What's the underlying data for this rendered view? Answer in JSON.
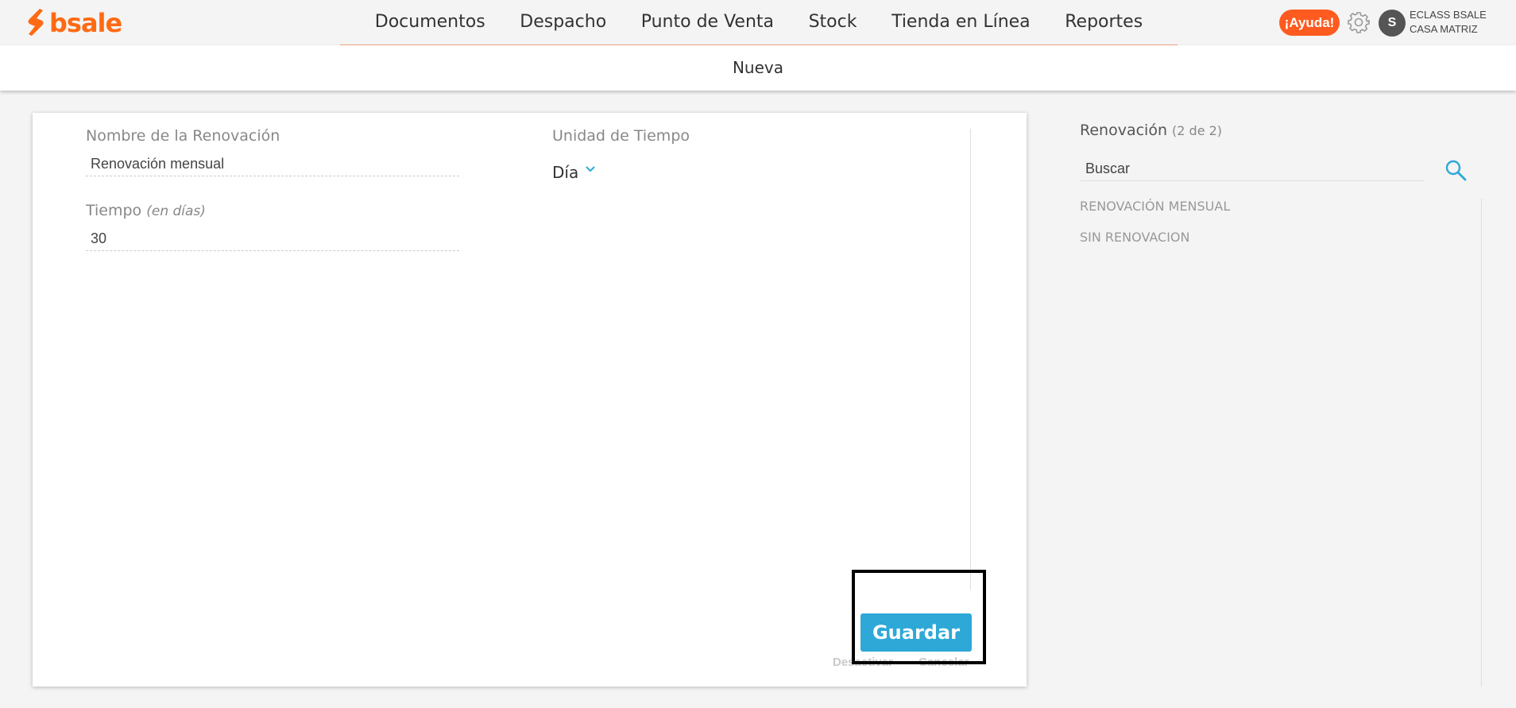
{
  "app": {
    "logo_text": "bsale",
    "brand_color": "#ff6a13"
  },
  "nav": {
    "items": [
      {
        "label": "Documentos"
      },
      {
        "label": "Despacho"
      },
      {
        "label": "Punto de Venta"
      },
      {
        "label": "Stock"
      },
      {
        "label": "Tienda en Línea"
      },
      {
        "label": "Reportes"
      }
    ]
  },
  "header": {
    "help_label": "¡Ayuda!",
    "settings_icon": "gear-icon",
    "avatar_initial": "S",
    "company_line1": "ECLASS BSALE",
    "company_line2": "CASA MATRIZ"
  },
  "subheader": {
    "title": "Nueva"
  },
  "form": {
    "name_label": "Nombre de la Renovación",
    "name_value": "Renovación mensual",
    "time_label": "Tiempo",
    "time_hint": "(en días)",
    "time_value": "30",
    "unit_label": "Unidad de Tiempo",
    "unit_value": "Día",
    "save_label": "Guardar",
    "deactivate_label": "Desactivar",
    "cancel_label": "Cancelar",
    "save_color": "#2ea8d6"
  },
  "sidebar": {
    "title": "Renovación",
    "count": "(2 de 2)",
    "search_placeholder": "Buscar",
    "items": [
      {
        "label": "RENOVACIÓN MENSUAL"
      },
      {
        "label": "SIN RENOVACION"
      }
    ]
  }
}
